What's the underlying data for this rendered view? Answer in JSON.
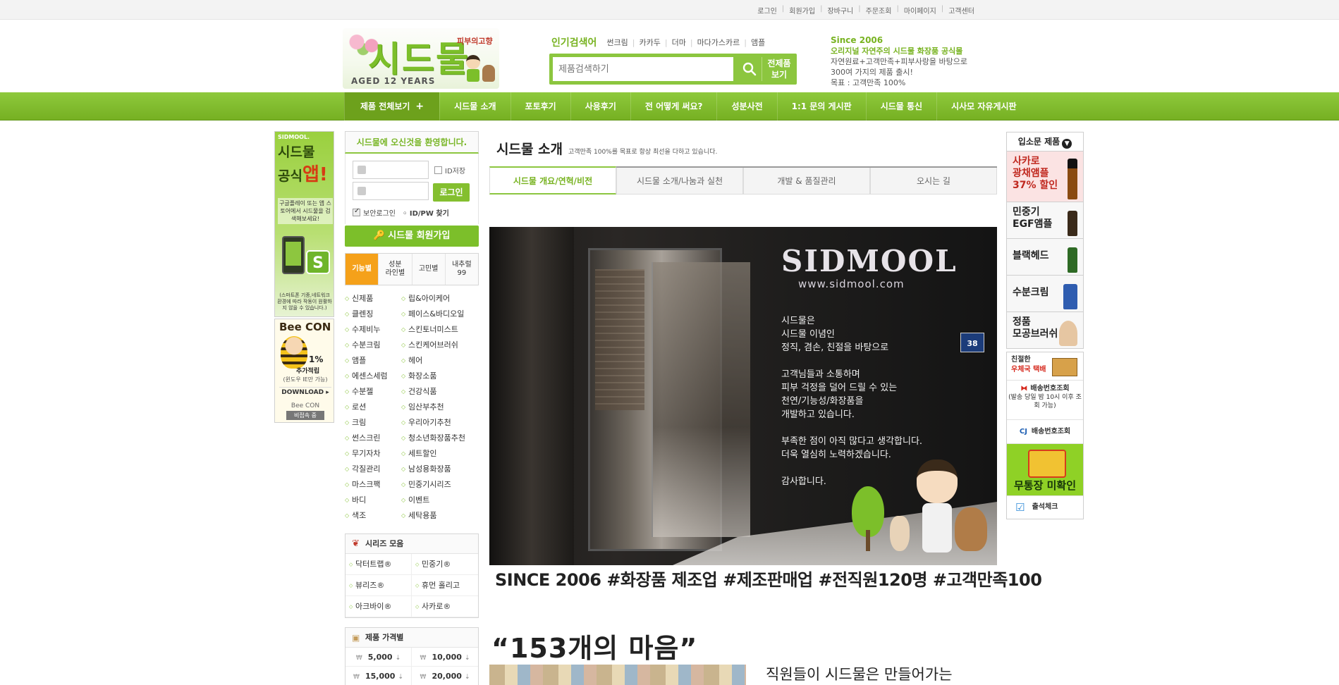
{
  "top_links": [
    "로그인",
    "회원가입",
    "장바구니",
    "주문조회",
    "마이페이지",
    "고객센터"
  ],
  "logo": {
    "name": "시드물",
    "tag": "피부의고향",
    "aged": "AGED 12 YEARS"
  },
  "popular": {
    "title": "인기검색어",
    "keywords": [
      "썬크림",
      "카카두",
      "더마",
      "마다가스카르",
      "앰플"
    ]
  },
  "search": {
    "placeholder": "제품검색하기",
    "all_label": "전제품\n보기"
  },
  "since_block": {
    "line1": "Since 2006",
    "line2": "오리지널 자연주의 시드물 화장품 공식몰",
    "line3": "자연원료+고객만족+피부사랑을 바탕으로",
    "line4": "300여 가지의 제품 출시!",
    "line5": "목표 : 고객만족 100%"
  },
  "nav": {
    "first": "제품 전체보기",
    "items": [
      "시드물 소개",
      "포토후기",
      "사용후기",
      "전 어떻게 써요?",
      "성분사전",
      "1:1 문의 게시판",
      "시드물 통신",
      "시사모 자유게시판"
    ]
  },
  "app_banner": {
    "small": "SIDMOOL.",
    "line1": "시드물",
    "line2a": "공식",
    "line2b": "앱!",
    "desc": "구글플레이 또는 앱 스토어에서 시드물을 검색해보세요!",
    "badge": "S",
    "note": "(스마트폰 기종,네트워크 환경에 따라 작동이 원활하지 않을 수 있습니다.)"
  },
  "beecon": {
    "title": "Bee CON",
    "pct": "1%",
    "pct2": "추가적립",
    "win": "(윈도우 IE만 가능)",
    "download": "DOWNLOAD ▸",
    "brand": "Bee CON",
    "badge": "비접속 중"
  },
  "login": {
    "welcome": "시드물에 오신것을 환영합니다.",
    "save_id": "ID저장",
    "login_btn": "로그인",
    "secure": "보안로그인",
    "find": "◦ ID/PW 찾기",
    "join": "시드물 회원가입"
  },
  "cat_tabs": [
    "기능별",
    "성분\n라인별",
    "고민별",
    "내추럴\n99"
  ],
  "categories": [
    "신제품",
    "립&아이케어",
    "클렌징",
    "페이스&바디오일",
    "수제비누",
    "스킨토너미스트",
    "수분크림",
    "스킨케어브러쉬",
    "앰플",
    "헤어",
    "에센스세럼",
    "화장소품",
    "수분젤",
    "건강식품",
    "로션",
    "임산부추천",
    "크림",
    "우리아기추천",
    "썬스크린",
    "청소년화장품추천",
    "무기자차",
    "세트할인",
    "각질관리",
    "남성용화장품",
    "마스크팩",
    "민중기시리즈",
    "바디",
    "이벤트",
    "색조",
    "세탁용품"
  ],
  "series": {
    "title": "시리즈 모음",
    "items": [
      "닥터트랩®",
      "민중기®",
      "뷰리즈®",
      "휴먼 홀리고",
      "아크바이®",
      "사카로®"
    ]
  },
  "prices": {
    "title": "제품 가격별",
    "items": [
      "5,000",
      "10,000",
      "15,000",
      "20,000"
    ]
  },
  "content": {
    "title": "시드물 소개",
    "subtitle": "고객만족 100%를 목표로 항상 최선을 다하고 있습니다.",
    "tabs": [
      "시드물 개요/연혁/비전",
      "시드물 소개/나눔과 실천",
      "개발 & 품질관리",
      "오시는 길"
    ],
    "photo_brand": "SIDMOOL",
    "photo_url": "www.sidmool.com",
    "photo_msg": "시드물은\n시드물 이념인\n정직, 겸손, 친절을 바탕으로\n\n고객님들과 소통하며\n피부 걱정을 덜어 드릴 수 있는\n천연/기능성/화장품을\n개발하고 있습니다.\n\n부족한 점이 아직 많다고 생각합니다.\n더욱 열심히 노력하겠습니다.\n\n감사합니다.",
    "plate": "38",
    "since_line": "SINCE 2006 #화장품 제조업 #제조판매업 #전직원120명 #고객만족100",
    "quote": "“153개의 마음”",
    "staff": "직원들이 시드물은 만들어가는"
  },
  "right": {
    "head": "입소문 제품",
    "products": [
      {
        "l1": "사카로",
        "l2": "광채앰플",
        "l3": "37% 할인"
      },
      {
        "l1": "민중기",
        "l2": "EGF앰플"
      },
      {
        "l1": "블랙헤드"
      },
      {
        "l1": "수분크림"
      },
      {
        "l1": "정품",
        "l2": "모공브러쉬"
      }
    ],
    "ship1a": "친절한",
    "ship1b": "우체국 택배",
    "ship2": "배송번호조회",
    "ship2sub": "(발송 당일 밤 10시 이후 조회 가능)",
    "cj": "CJ",
    "ship3": "배송번호조회",
    "unpaid": "무통장 미확인",
    "attend": "출석체크"
  }
}
